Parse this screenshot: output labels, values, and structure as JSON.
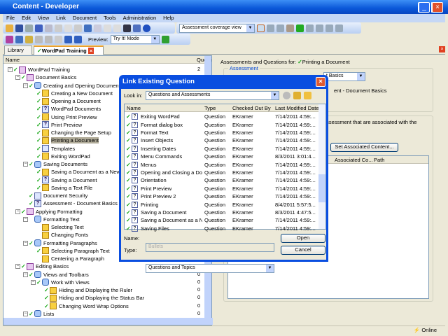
{
  "window": {
    "title": "Content - Developer"
  },
  "menu": [
    "File",
    "Edit",
    "View",
    "Link",
    "Document",
    "Tools",
    "Administration",
    "Help"
  ],
  "toolbar": {
    "view_combo": "Assessment coverage view",
    "preview_label": "Preview:",
    "preview_mode": "Try It! Mode"
  },
  "tabs": {
    "library": "Library",
    "doc": "WordPad Training"
  },
  "tree": {
    "col_name": "Name",
    "col_count": "Questi",
    "rows": [
      {
        "l": 0,
        "t": "WordPad Training",
        "i": "book",
        "c": true,
        "n": "2"
      },
      {
        "l": 1,
        "t": "Document Basics",
        "i": "book",
        "c": true,
        "n": "0"
      },
      {
        "l": 2,
        "t": "Creating and Opening Documents",
        "i": "mod",
        "c": true,
        "n": "0"
      },
      {
        "l": 3,
        "t": "Creating a New Document",
        "i": "topic",
        "c": true,
        "n": "0"
      },
      {
        "l": 3,
        "t": "Opening a Document",
        "i": "topic",
        "c": true,
        "n": "0"
      },
      {
        "l": 3,
        "t": "WordPad Documents",
        "i": "q",
        "c": true,
        "n": "0"
      },
      {
        "l": 3,
        "t": "Using Print Preview",
        "i": "topic",
        "c": true,
        "n": "0"
      },
      {
        "l": 3,
        "t": "Print Preview",
        "i": "q",
        "c": true,
        "n": "0"
      },
      {
        "l": 3,
        "t": "Changing the Page Setup",
        "i": "topic",
        "c": true,
        "n": "0"
      },
      {
        "l": 3,
        "t": "Printing a Document",
        "i": "topic",
        "c": true,
        "n": "0",
        "sel": true
      },
      {
        "l": 3,
        "t": "Templates",
        "i": "doc",
        "c": true,
        "n": "0"
      },
      {
        "l": 3,
        "t": "Exiting WordPad",
        "i": "topic",
        "c": true,
        "n": "0"
      },
      {
        "l": 2,
        "t": "Saving Documents",
        "i": "mod",
        "c": true,
        "n": "0"
      },
      {
        "l": 3,
        "t": "Saving a Document as a New File",
        "i": "topic",
        "c": true,
        "n": "0"
      },
      {
        "l": 3,
        "t": "Saving a Document",
        "i": "q",
        "c": true,
        "n": "0"
      },
      {
        "l": 3,
        "t": "Saving a Text File",
        "i": "topic",
        "c": true,
        "n": "0"
      },
      {
        "l": 2,
        "t": "Document Security",
        "i": "doc",
        "c": true,
        "n": "0"
      },
      {
        "l": 2,
        "t": "Assessment - Document Basics",
        "i": "q",
        "c": true,
        "n": "0"
      },
      {
        "l": 1,
        "t": "Applying Formatting",
        "i": "book",
        "c": true,
        "n": "0"
      },
      {
        "l": 2,
        "t": "Formatting Text",
        "i": "mod",
        "c": false,
        "n": "0"
      },
      {
        "l": 3,
        "t": "Selecting Text",
        "i": "topic",
        "c": false,
        "n": "0"
      },
      {
        "l": 3,
        "t": "Changing Fonts",
        "i": "topic",
        "c": false,
        "n": "0"
      },
      {
        "l": 2,
        "t": "Formatting Paragraphs",
        "i": "mod",
        "c": true,
        "n": "0"
      },
      {
        "l": 3,
        "t": "Selecting Paragraph Text",
        "i": "topic",
        "c": true,
        "n": "0"
      },
      {
        "l": 3,
        "t": "Centering a Paragraph",
        "i": "topic",
        "c": false,
        "n": "0"
      },
      {
        "l": 1,
        "t": "Editing Basics",
        "i": "book",
        "c": true,
        "n": "0"
      },
      {
        "l": 2,
        "t": "Views and Toolbars",
        "i": "mod",
        "c": true,
        "n": "0"
      },
      {
        "l": 3,
        "t": "Work with Views",
        "i": "mod",
        "c": true,
        "n": "0"
      },
      {
        "l": 4,
        "t": "Hiding and Displaying the Ruler",
        "i": "topic",
        "c": true,
        "n": "0"
      },
      {
        "l": 4,
        "t": "Hiding and Displaying the Status Bar",
        "i": "topic",
        "c": true,
        "n": "0"
      },
      {
        "l": 4,
        "t": "Changing Word Wrap Options",
        "i": "topic",
        "c": true,
        "n": "0"
      },
      {
        "l": 2,
        "t": "Lists",
        "i": "mod",
        "c": true,
        "n": "0"
      }
    ]
  },
  "right": {
    "heading": "Assessments and Questions for:",
    "item": "Printing a Document",
    "group1": "Assessment",
    "combo": "t Basics",
    "assess_text": "ent - Document Basics",
    "group2_text": "assessment that are associated with the",
    "set_button": "Set Associated Content...",
    "cols": [
      "Associated Co...",
      "Path"
    ]
  },
  "dialog": {
    "title": "Link Existing Question",
    "look_in_label": "Look in:",
    "look_in": "Questions and Assessments",
    "cols": [
      "Name",
      "Type",
      "Checked Out By",
      "Last Modified Date"
    ],
    "rows": [
      [
        "Exiting WordPad",
        "Question",
        "EKramer",
        "7/14/2011 4:59:..."
      ],
      [
        "Format dialog box",
        "Question",
        "EKramer",
        "7/14/2011 4:59:..."
      ],
      [
        "Format Text",
        "Question",
        "EKramer",
        "7/14/2011 4:59:..."
      ],
      [
        "Insert Objects",
        "Question",
        "EKramer",
        "7/14/2011 4:59:..."
      ],
      [
        "Inserting Dates",
        "Question",
        "EKramer",
        "7/14/2011 4:59:..."
      ],
      [
        "Menu Commands",
        "Question",
        "EKramer",
        "8/3/2011 3:01:4..."
      ],
      [
        "Menus",
        "Question",
        "EKramer",
        "7/14/2011 4:59:..."
      ],
      [
        "Opening and Closing a Docu...",
        "Question",
        "EKramer",
        "7/14/2011 4:59:..."
      ],
      [
        "Orientation",
        "Question",
        "EKramer",
        "7/14/2011 4:59:..."
      ],
      [
        "Print Preview",
        "Question",
        "EKramer",
        "7/14/2011 4:59:..."
      ],
      [
        "Print Preview 2",
        "Question",
        "EKramer",
        "7/14/2011 4:59:..."
      ],
      [
        "Printing",
        "Question",
        "EKramer",
        "8/4/2011 5:57:5..."
      ],
      [
        "Saving a Document",
        "Question",
        "EKramer",
        "8/3/2011 4:47:5..."
      ],
      [
        "Saving a Document as a Ne...",
        "Question",
        "EKramer",
        "7/14/2011 4:59:..."
      ],
      [
        "Saving Files",
        "Question",
        "EKramer",
        "7/14/2011 4:59:..."
      ]
    ],
    "name_label": "Name:",
    "name_value": "Bullets",
    "type_label": "Type:",
    "type_value": "Questions and Topics",
    "open": "Open",
    "cancel": "Cancel"
  },
  "status": {
    "text": "Online"
  }
}
